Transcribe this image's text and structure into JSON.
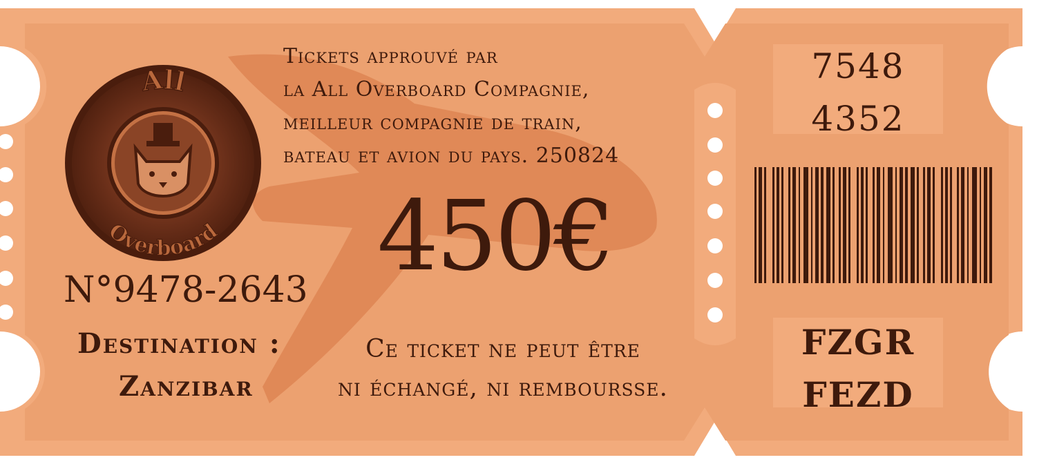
{
  "ticket": {
    "approval_lines": [
      "Tickets approuvé par",
      "la All Overboard Compagnie,",
      "meilleur compagnie de train,",
      "bateau et  avion du pays. 250824"
    ],
    "price": "450€",
    "number": "N°9478-2643",
    "destination_label": "Destination :",
    "destination_value": "Zanzibar",
    "notice_lines": [
      "Ce ticket ne peut être",
      "ni échangé, ni remboursse."
    ]
  },
  "logo": {
    "top_text": "All",
    "bottom_text": "Overboard",
    "icon": "cat-with-top-hat-icon"
  },
  "stub": {
    "serial_lines": [
      "7548",
      "4352"
    ],
    "code_lines": [
      "FZGR",
      "FEZD"
    ],
    "barcode_icon": "barcode-icon"
  },
  "colors": {
    "ticket_fill": "#f2ab7c",
    "ticket_inner": "#eba06f",
    "watermark": "#de8552",
    "ink": "#3e1a0c",
    "seal_dark": "#5a2614",
    "seal_mid": "#8a4426",
    "seal_light": "#c47144"
  }
}
